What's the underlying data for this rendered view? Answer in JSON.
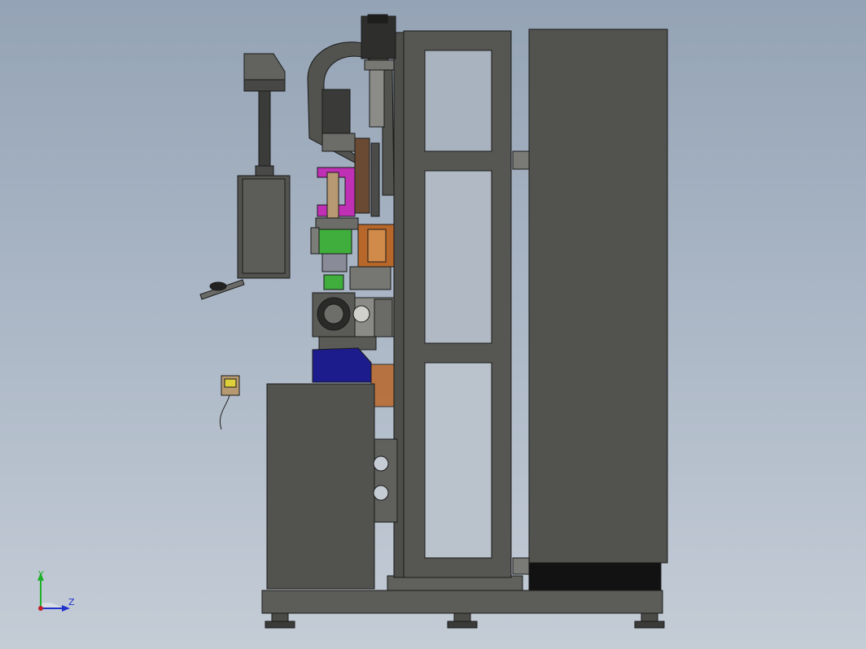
{
  "triad": {
    "y_label": "Y",
    "z_label": "Z",
    "y_color": "#1fae2a",
    "z_color": "#2233cc",
    "origin_color": "#c0202a"
  },
  "colors": {
    "background_top": "#94a3b5",
    "background_bottom": "#c4ccd6",
    "frame": "#565752",
    "cabinet": "#52534e",
    "dark_part": "#3e3f3c",
    "magenta_part": "#c030b4",
    "green_part": "#3fae3c",
    "blue_part": "#1c1c8c",
    "orange_part": "#b8672a",
    "tan_part": "#b89a72"
  }
}
